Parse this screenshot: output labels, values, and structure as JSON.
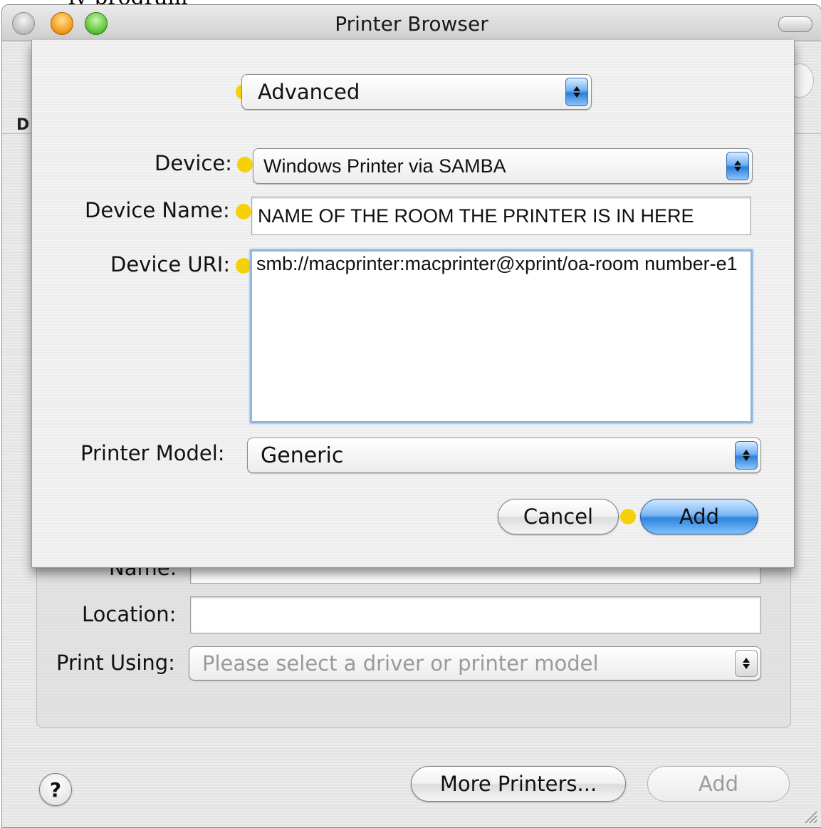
{
  "window": {
    "title": "Printer Browser"
  },
  "background": {
    "partial_label": "D",
    "name_label": "Name:",
    "location_label": "Location:",
    "location_value": "",
    "print_using_label": "Print Using:",
    "print_using_value": "Please select a driver or printer model",
    "more_printers_label": "More Printers...",
    "add_label": "Add",
    "help_label": "?"
  },
  "sheet": {
    "connection_type": "Advanced",
    "device_label": "Device:",
    "device_value": "Windows Printer via SAMBA",
    "device_name_label": "Device Name:",
    "device_name_value": "NAME OF THE ROOM THE PRINTER IS IN HERE",
    "device_uri_label": "Device URI:",
    "device_uri_value": "smb://macprinter:macprinter@xprint/oa-room number-e1",
    "printer_model_label": "Printer Model:",
    "printer_model_value": "Generic",
    "cancel_label": "Cancel",
    "add_label": "Add"
  },
  "colors": {
    "highlight_dot": "#f5d10a",
    "default_button": "#2f84dc"
  }
}
